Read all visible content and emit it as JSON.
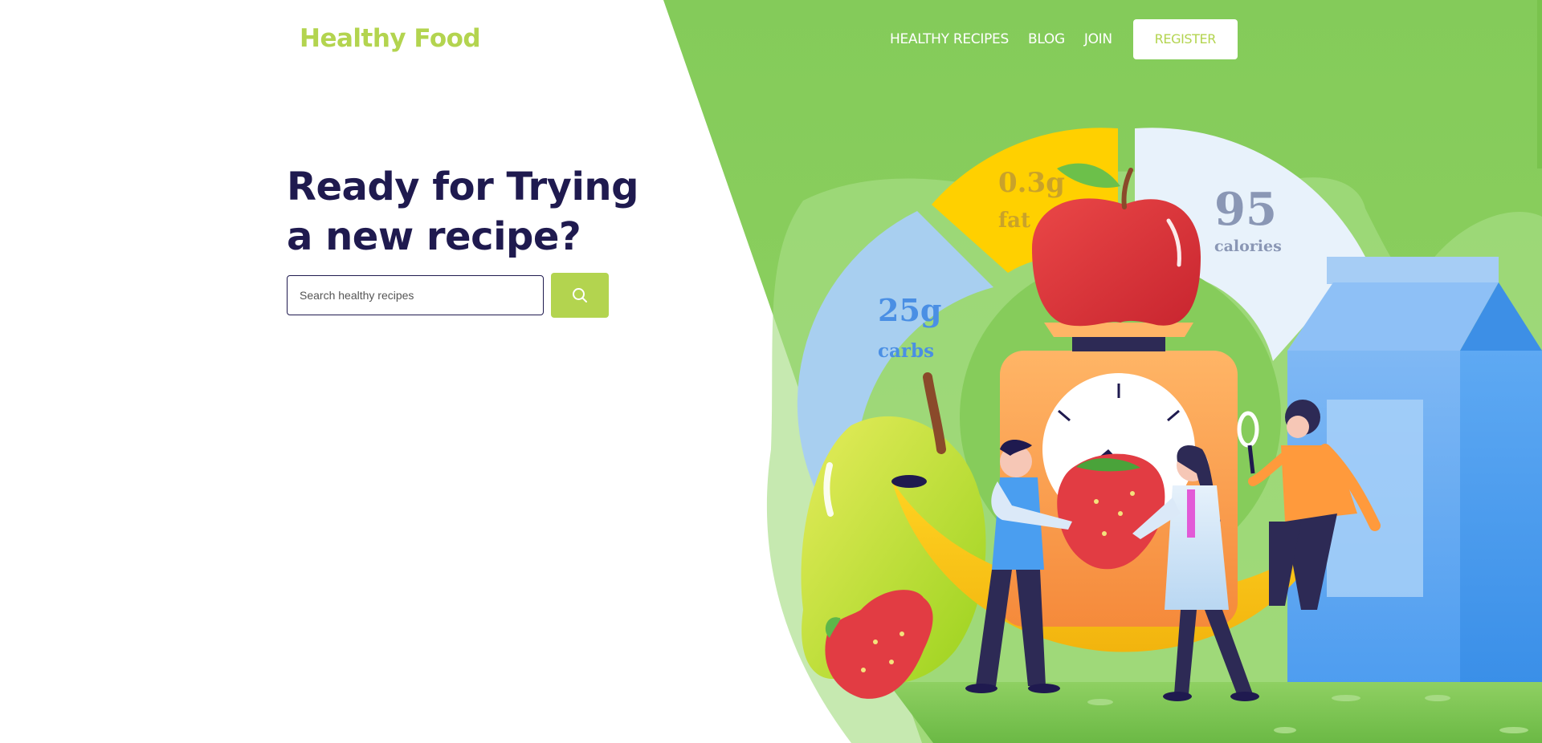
{
  "header": {
    "brand": "Healthy Food",
    "nav": [
      {
        "label": "HEALTHY RECIPES"
      },
      {
        "label": "BLOG"
      },
      {
        "label": "JOIN"
      }
    ],
    "register_label": "REGISTER"
  },
  "hero": {
    "title_line1": "Ready for Trying",
    "title_line2": "a new recipe?",
    "search": {
      "placeholder": "Search healthy recipes",
      "value": "",
      "icon": "search-icon"
    }
  },
  "illustration": {
    "nutrition": {
      "fat_value": "0.3g",
      "fat_label": "fat",
      "calories_value": "95",
      "calories_label": "calories",
      "carbs_value": "25g",
      "carbs_label": "carbs"
    }
  },
  "colors": {
    "brand_green": "#b3d44f",
    "hero_green": "#8dcd5e",
    "navy": "#1f1a4f",
    "fat_yellow": "#ffd000",
    "carbs_blue": "#a8cff0",
    "calories_pale": "#e8f2fb",
    "milk_blue": "#4a9ef0"
  }
}
